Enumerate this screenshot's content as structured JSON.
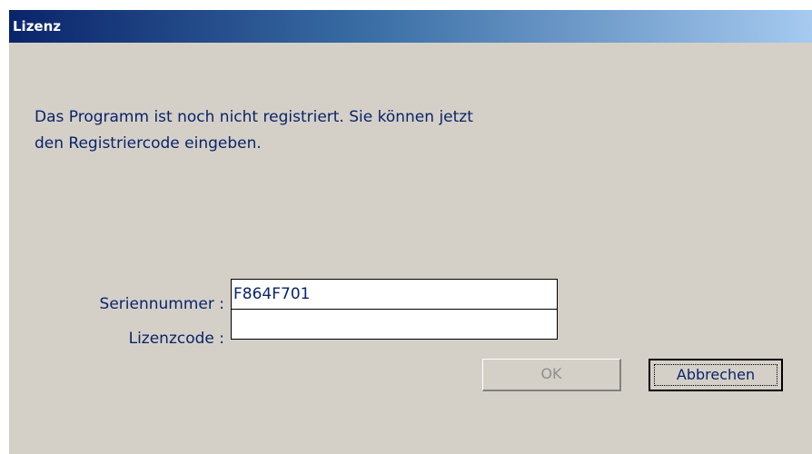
{
  "window": {
    "title": "Lizenz"
  },
  "message": {
    "line1": "Das Programm ist noch nicht registriert. Sie können jetzt",
    "line2": "den Registriercode eingeben."
  },
  "form": {
    "serial_label": "Seriennummer :",
    "serial_value": "F864F701",
    "license_label": "Lizenzcode :",
    "license_value": ""
  },
  "buttons": {
    "ok_label": "OK",
    "cancel_label": "Abbrechen"
  },
  "colors": {
    "text": "#0a246a",
    "dialog_bg": "#d4d0c8",
    "title_gradient_start": "#0a246a",
    "title_gradient_end": "#a6caf0",
    "disabled_text": "#8e8e8e"
  }
}
